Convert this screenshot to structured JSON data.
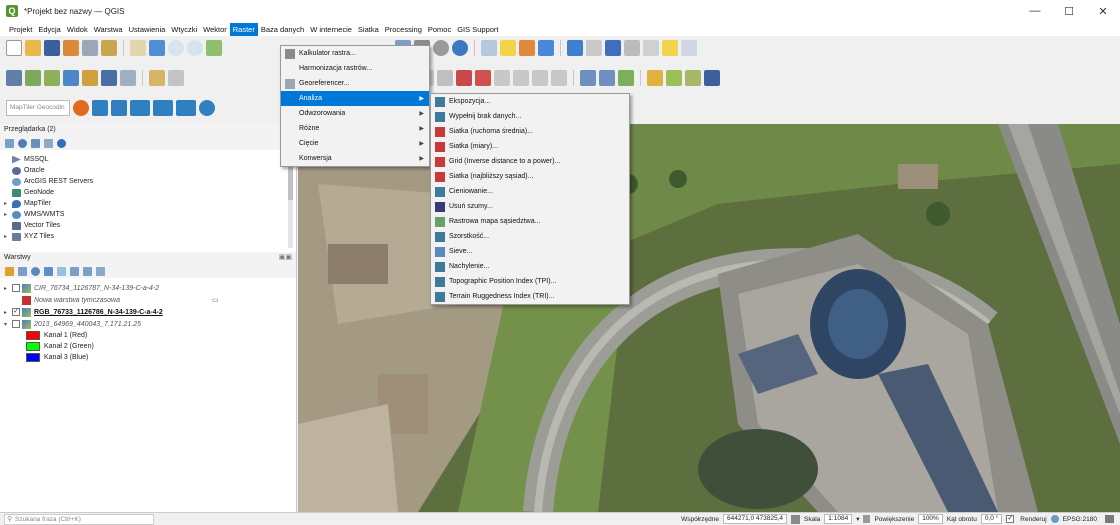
{
  "window": {
    "title": "*Projekt bez nazwy — QGIS",
    "min": "—",
    "max": "☐",
    "close": "✕"
  },
  "menubar": [
    "Projekt",
    "Edycja",
    "Widok",
    "Warstwa",
    "Ustawienia",
    "Wtyczki",
    "Wektor",
    "Raster",
    "Baza danych",
    "W internecie",
    "Siatka",
    "Processing",
    "Pomoc",
    "GIS Support"
  ],
  "toolbar": {
    "geocoder_placeholder": "MapTiler Geocodin"
  },
  "browser": {
    "title": "Przeglądarka (2)",
    "items": [
      {
        "label": "MSSQL",
        "icon": "mssql-icon"
      },
      {
        "label": "Oracle",
        "icon": "oracle-icon"
      },
      {
        "label": "ArcGIS REST Servers",
        "icon": "arcgis-icon"
      },
      {
        "label": "GeoNode",
        "icon": "geonode-icon"
      },
      {
        "label": "MapTiler",
        "icon": "maptiler-icon"
      },
      {
        "label": "WMS/WMTS",
        "icon": "wms-icon"
      },
      {
        "label": "Vector Tiles",
        "icon": "vector-tiles-icon"
      },
      {
        "label": "XYZ Tiles",
        "icon": "xyz-tiles-icon"
      }
    ]
  },
  "layers": {
    "title": "Warstwy",
    "rows": [
      {
        "label": "CIR_76734_1126787_N-34-139-C-a-4-2",
        "style": "it"
      },
      {
        "label": "Nowa warstwa tymczasowa",
        "style": "it"
      },
      {
        "label": "RGB_76733_1126786_N-34-139-C-a-4-2",
        "style": "bold"
      },
      {
        "label": "2013_64969_440043_7.171.21.25",
        "style": "it"
      }
    ],
    "bands": [
      {
        "label": "Kanał 1 (Red)",
        "color": "#ff0000"
      },
      {
        "label": "Kanał 2 (Green)",
        "color": "#00ff00"
      },
      {
        "label": "Kanał 3 (Blue)",
        "color": "#0000ff"
      }
    ]
  },
  "raster_menu": {
    "items": [
      {
        "label": "Kalkulator rastra...",
        "icon": "calculator-icon"
      },
      {
        "label": "Harmonizacja rastrów..."
      },
      {
        "label": "Georeferencer...",
        "icon": "georeferencer-icon"
      },
      {
        "label": "Analiza",
        "submenu": true
      },
      {
        "label": "Odwzorowania",
        "submenu": true
      },
      {
        "label": "Różne",
        "submenu": true
      },
      {
        "label": "Cięcie",
        "submenu": true
      },
      {
        "label": "Konwersja",
        "submenu": true
      }
    ]
  },
  "analysis_menu": {
    "items": [
      "Ekspozycja...",
      "Wypełnij brak danych...",
      "Siatka (ruchoma średnia)...",
      "Siatka (miary)...",
      "Grid (Inverse distance to a power)...",
      "Siatka (najbliższy sąsiad)...",
      "Cieniowanie...",
      "Usuń szumy...",
      "Rastrowa mapa sąsiedztwa...",
      "Szorstkość...",
      "Sieve...",
      "Nachylenie...",
      "Topographic Position Index (TPI)...",
      "Terrain Ruggedness Index (TRI)..."
    ]
  },
  "statusbar": {
    "search_placeholder": "Szukana fraza (Ctrl+K)",
    "coord_label": "Współrzędne",
    "coord_value": "644271,0 473825,4",
    "scale_label": "Skala",
    "scale_value": "1:1084",
    "magnifier_label": "Powiększenie",
    "magnifier_value": "100%",
    "rotation_label": "Kąt obrotu",
    "rotation_value": "0,0 °",
    "render_label": "Renderuj",
    "crs": "EPSG:2180"
  }
}
